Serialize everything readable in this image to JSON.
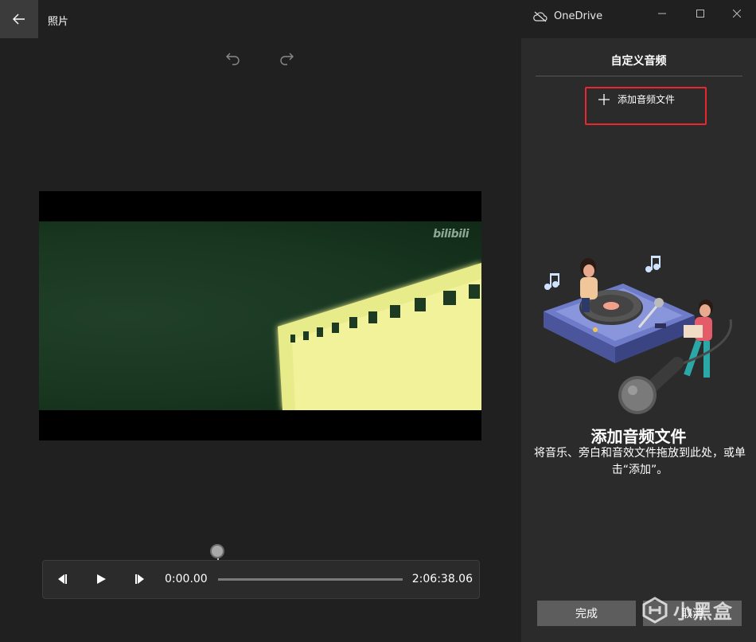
{
  "app": {
    "title": "照片",
    "cloud_label": "OneDrive"
  },
  "panel": {
    "title": "自定义音频",
    "add_audio_label": "添加音频文件",
    "empty_title": "添加音频文件",
    "empty_description": "将音乐、旁白和音效文件拖放到此处，或单击“添加”。",
    "done_label": "完成",
    "cancel_label": "取消"
  },
  "playback": {
    "current_time": "0:00.00",
    "total_time": "2:06:38.06",
    "progress": 0
  },
  "video": {
    "watermark": "bilibili"
  },
  "site_watermark": "小黑盒",
  "colors": {
    "highlight": "#e8282e",
    "background": "#202020",
    "panel": "#2b2b2b"
  }
}
